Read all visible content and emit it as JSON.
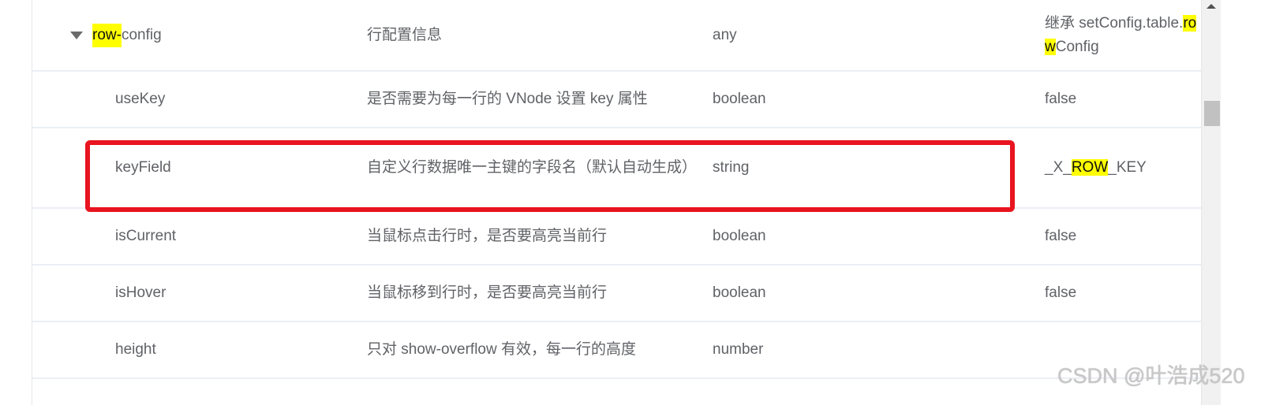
{
  "rows": [
    {
      "name_hl": "row-",
      "name_rest": "config",
      "desc": "行配置信息",
      "type": "any",
      "default_pre": "继承 setConfig.table.",
      "default_hl": "row",
      "default_rest": "Config",
      "expanded": true
    },
    {
      "name": "useKey",
      "desc": "是否需要为每一行的 VNode 设置 key 属性",
      "type": "boolean",
      "default": "false"
    },
    {
      "name": "keyField",
      "desc": "自定义行数据唯一主键的字段名（默认自动生成）",
      "type": "string",
      "default_pre": "_X_",
      "default_hl": "ROW",
      "default_rest": "_KEY",
      "highlighted_box": true
    },
    {
      "name": "isCurrent",
      "desc": "当鼠标点击行时，是否要高亮当前行",
      "type": "boolean",
      "default": "false"
    },
    {
      "name": "isHover",
      "desc": "当鼠标移到行时，是否要高亮当前行",
      "type": "boolean",
      "default": "false"
    },
    {
      "name": "height",
      "desc": "只对 show-overflow 有效，每一行的高度",
      "type": "number",
      "default": ""
    }
  ],
  "watermark": "CSDN @叶浩成520",
  "colors": {
    "highlight": "#ffff00",
    "annotation_box": "#e8141f",
    "text": "#606266"
  }
}
